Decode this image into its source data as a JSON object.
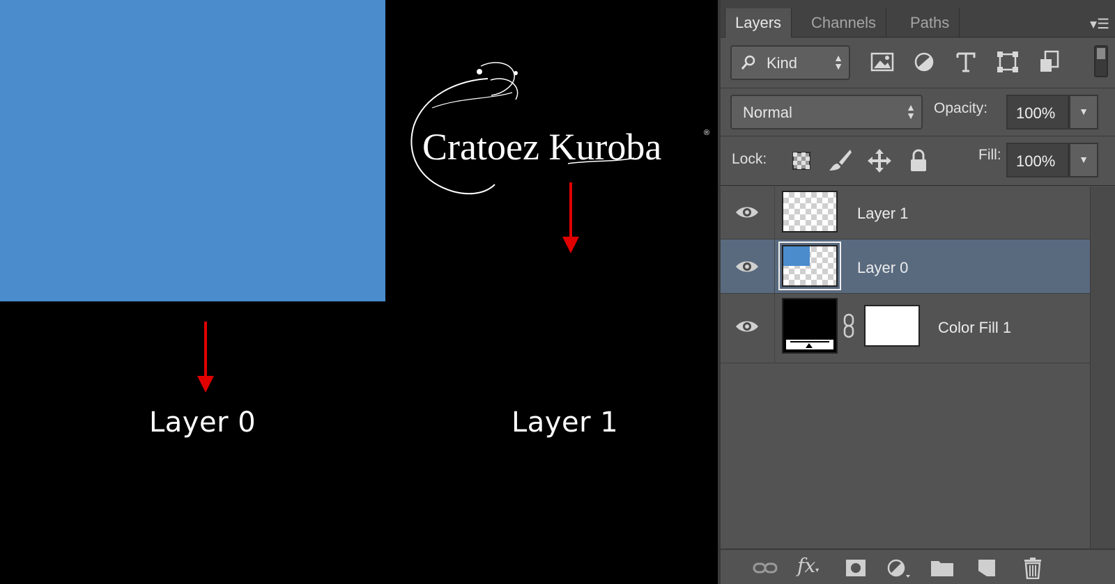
{
  "canvas": {
    "layer0_color": "#4a8ccc",
    "arrow_color": "#e00000",
    "caption_left": "Layer 0",
    "caption_right": "Layer 1",
    "watermark": "Cratoez Kuroba",
    "watermark_mark": "®"
  },
  "panel": {
    "tabs": [
      {
        "label": "Layers",
        "active": true
      },
      {
        "label": "Channels",
        "active": false
      },
      {
        "label": "Paths",
        "active": false
      }
    ],
    "menu_glyph": "▾☰",
    "filter": {
      "kind_label": "Kind",
      "icons": [
        "image-filter-icon",
        "adjustment-filter-icon",
        "type-filter-icon",
        "shape-filter-icon",
        "smart-object-filter-icon"
      ]
    },
    "blend": {
      "mode": "Normal",
      "opacity_label": "Opacity:",
      "opacity_value": "100%"
    },
    "lock": {
      "label": "Lock:",
      "fill_label": "Fill:",
      "fill_value": "100%",
      "icons": [
        "lock-transparent-icon",
        "lock-pixels-icon",
        "lock-position-icon",
        "lock-all-icon"
      ]
    },
    "layers": [
      {
        "name": "Layer 1",
        "visible": true,
        "selected": false
      },
      {
        "name": "Layer 0",
        "visible": true,
        "selected": true
      },
      {
        "name": "Color Fill 1",
        "visible": true,
        "selected": false
      }
    ],
    "bottom_icons": [
      "link-layers-icon",
      "fx-icon",
      "layer-mask-icon",
      "adjustment-layer-icon",
      "group-folder-icon",
      "new-layer-icon",
      "trash-icon"
    ],
    "fx_label": "fx"
  }
}
